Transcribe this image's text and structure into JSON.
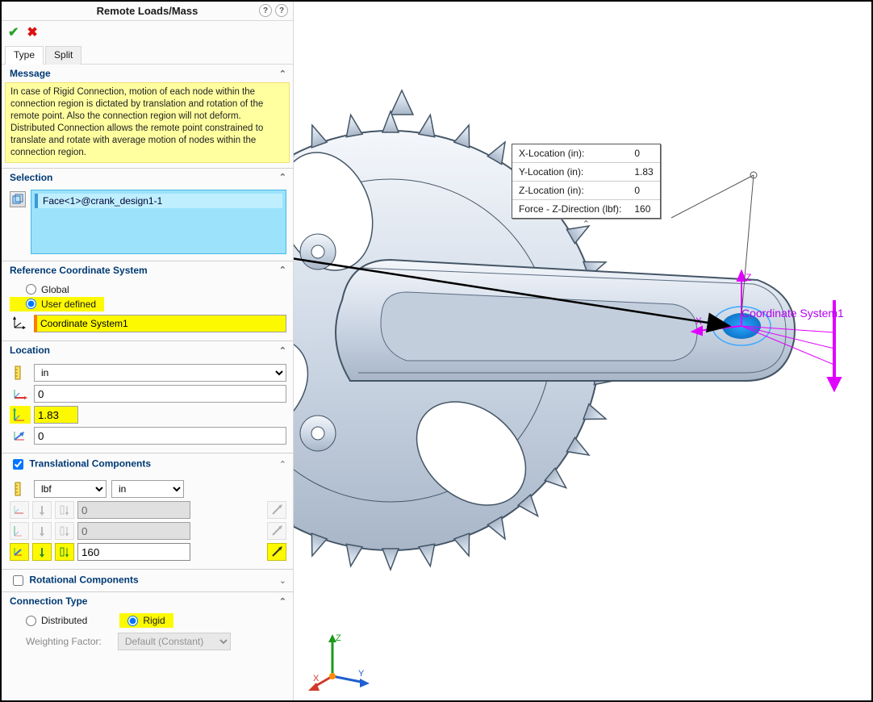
{
  "header": {
    "title": "Remote Loads/Mass"
  },
  "tabs": {
    "type": "Type",
    "split": "Split"
  },
  "message": {
    "title": "Message",
    "body": "In case of Rigid Connection, motion of each node within the connection region is dictated by translation and rotation of the remote point. Also the connection region will not deform. Distributed Connection allows the remote point constrained to translate and rotate with average motion of nodes within the connection region."
  },
  "selection": {
    "title": "Selection",
    "items": [
      "Face<1>@crank_design1-1"
    ]
  },
  "refcoord": {
    "title": "Reference Coordinate System",
    "global": "Global",
    "userdef": "User defined",
    "value": "Coordinate System1"
  },
  "location": {
    "title": "Location",
    "unit": "in",
    "x": "0",
    "y": "1.83",
    "z": "0"
  },
  "trans": {
    "title": "Translational Components",
    "force_unit": "lbf",
    "dist_unit": "in",
    "fx": "0",
    "fy": "0",
    "fz": "160"
  },
  "rot": {
    "title": "Rotational Components"
  },
  "conn": {
    "title": "Connection Type",
    "distributed": "Distributed",
    "rigid": "Rigid",
    "wf_label": "Weighting Factor:",
    "wf_value": "Default (Constant)"
  },
  "info_card": {
    "rows": [
      {
        "label": "X-Location (in):",
        "value": "0"
      },
      {
        "label": "Y-Location (in):",
        "value": "1.83"
      },
      {
        "label": "Z-Location (in):",
        "value": "0"
      },
      {
        "label": "Force -  Z-Direction (lbf):",
        "value": "160"
      }
    ]
  },
  "viewport": {
    "cs_label": "Coordinate System1"
  }
}
